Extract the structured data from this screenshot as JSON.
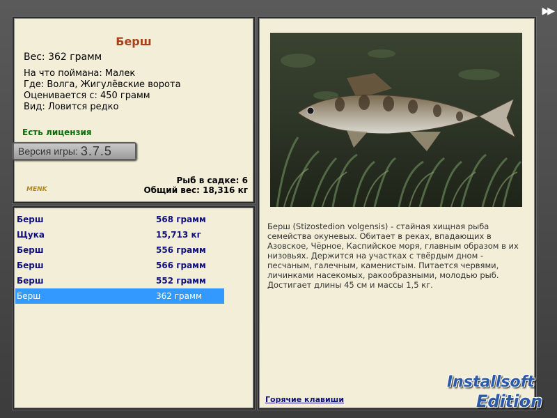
{
  "nav": {
    "forward_icon": "double-chevron-right-icon",
    "forward_glyph": "▶▶"
  },
  "info": {
    "title": "Берш",
    "weight": "Вес: 362 грамм",
    "caught_on": "На что поймана: Малек",
    "location": "Где: Волга, Жигулёвские ворота",
    "valued_from": "Оценивается с: 450 грамм",
    "rarity": "Вид: Ловится редко",
    "license": "Есть лицензия",
    "version_label": "Версия игры:",
    "version_number": "3.7.5",
    "fish_in_keepnet": "Рыб в садке: 6",
    "total_weight": "Общий вес: 18,316 кг",
    "small_logo": "MENK"
  },
  "catches": [
    {
      "name": "Берш",
      "weight": "568 грамм",
      "selected": false
    },
    {
      "name": "Щука",
      "weight": "15,713 кг",
      "selected": false
    },
    {
      "name": "Берш",
      "weight": "556 грамм",
      "selected": false
    },
    {
      "name": "Берш",
      "weight": "566 грамм",
      "selected": false
    },
    {
      "name": "Берш",
      "weight": "552 грамм",
      "selected": false
    },
    {
      "name": "Берш",
      "weight": "362 грамм",
      "selected": true
    }
  ],
  "description": {
    "text": "Берш (Stizostedion volgensis) - стайная хищная рыба семейства окуневых. Обитает в реках, впадающих в Азовское, Чёрное, Каспийское моря, главным образом в их низовьях. Держится на участках с твёрдым дном - песчаным, галечным, каменистым. Питается червями, личинками насекомых, ракообразными, молодью рыб. Достигает длины 45 см и массы 1,5 кг.",
    "hotkeys_link": "Горячие клавиши"
  },
  "watermark": {
    "line1": "Installsoft",
    "line2": "Edition"
  },
  "colors": {
    "panel_bg": "#f2eed8",
    "title": "#a8401a",
    "license": "#0a6b0a",
    "list_text": "#101080",
    "selection": "#3399ff"
  }
}
